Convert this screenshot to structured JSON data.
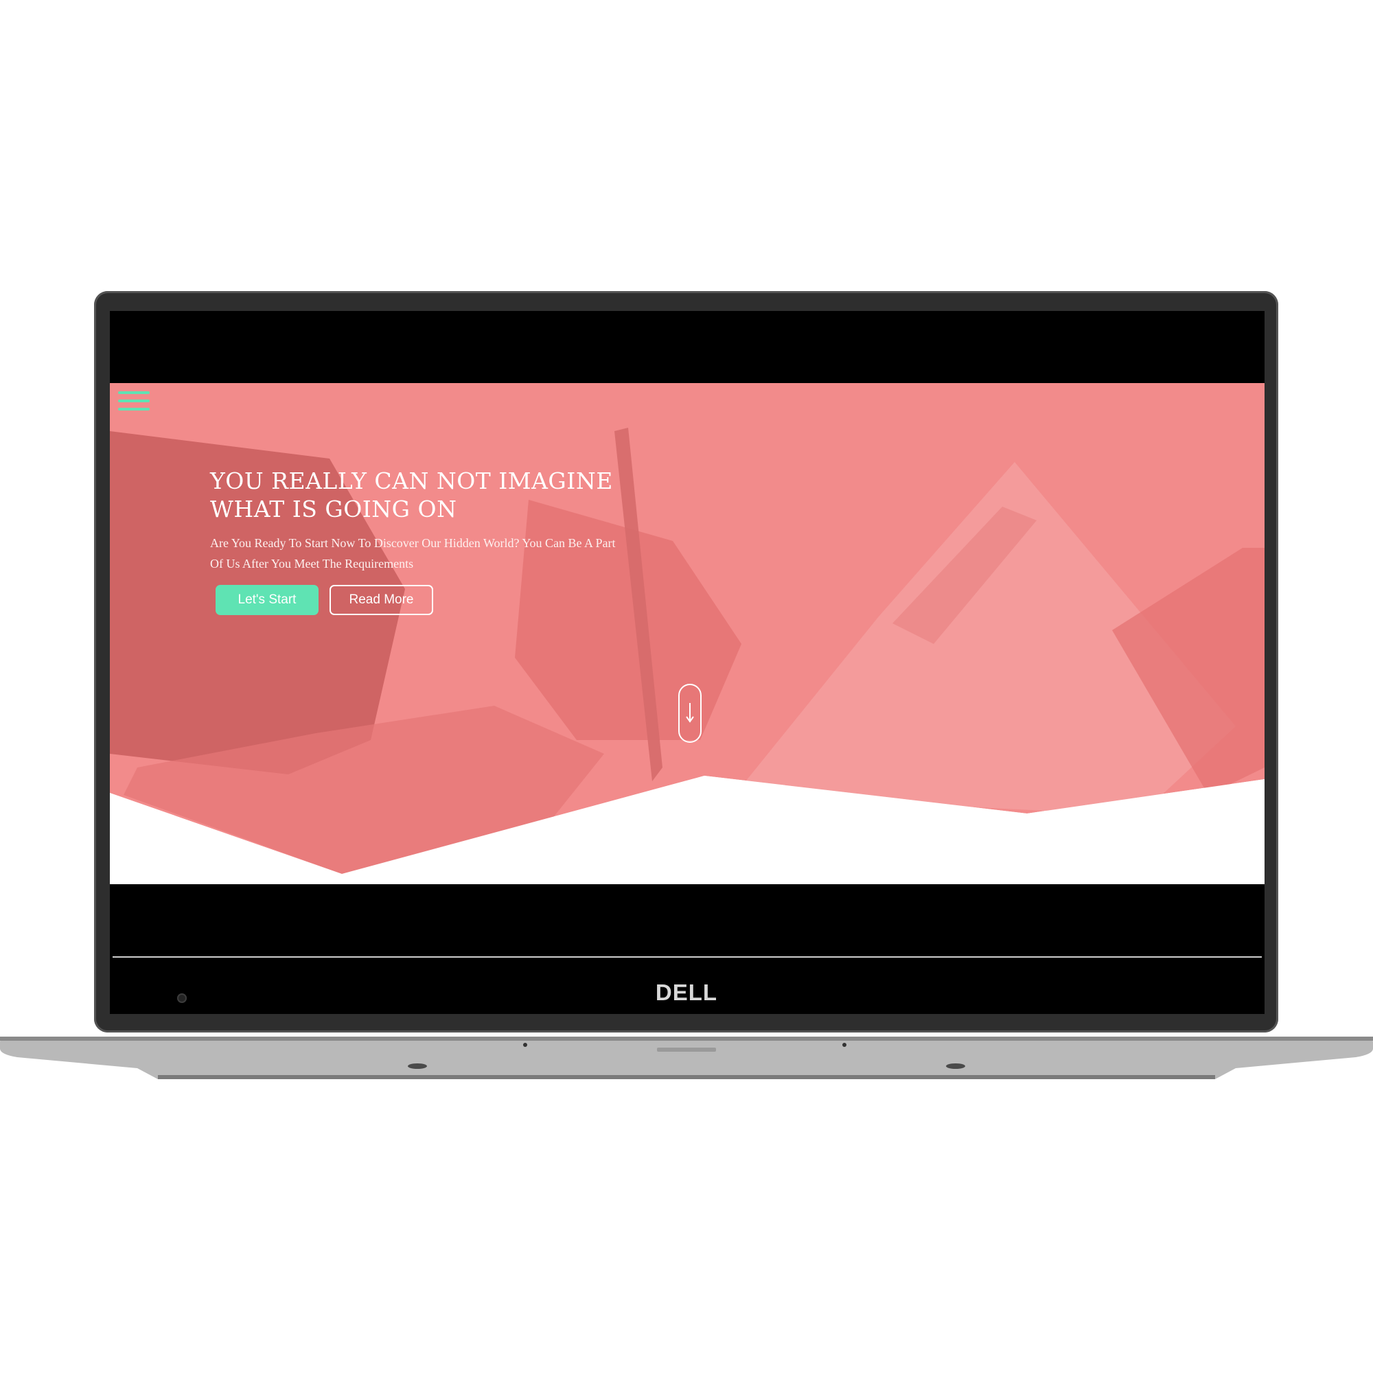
{
  "device": {
    "brand_logo": "DELL"
  },
  "page": {
    "menu_icon": "hamburger-menu-icon",
    "hero": {
      "title_line1": "YOU REALLY CAN NOT IMAGINE",
      "title_line2": "WHAT IS GOING ON",
      "subtitle_line1": "Are You Ready To Start Now To Discover Our Hidden World? You Can Be A Part",
      "subtitle_line2": "Of Us After You Meet The Requirements",
      "primary_button": "Let's Start",
      "secondary_button": "Read More",
      "scroll_icon": "arrow-down-icon"
    }
  },
  "colors": {
    "accent": "#5fe3b3",
    "hero_overlay": "#f28b8b",
    "hero_dark": "#c95d5d",
    "laptop_bezel": "#2e2e2e",
    "laptop_body": "#b9b9b9"
  }
}
